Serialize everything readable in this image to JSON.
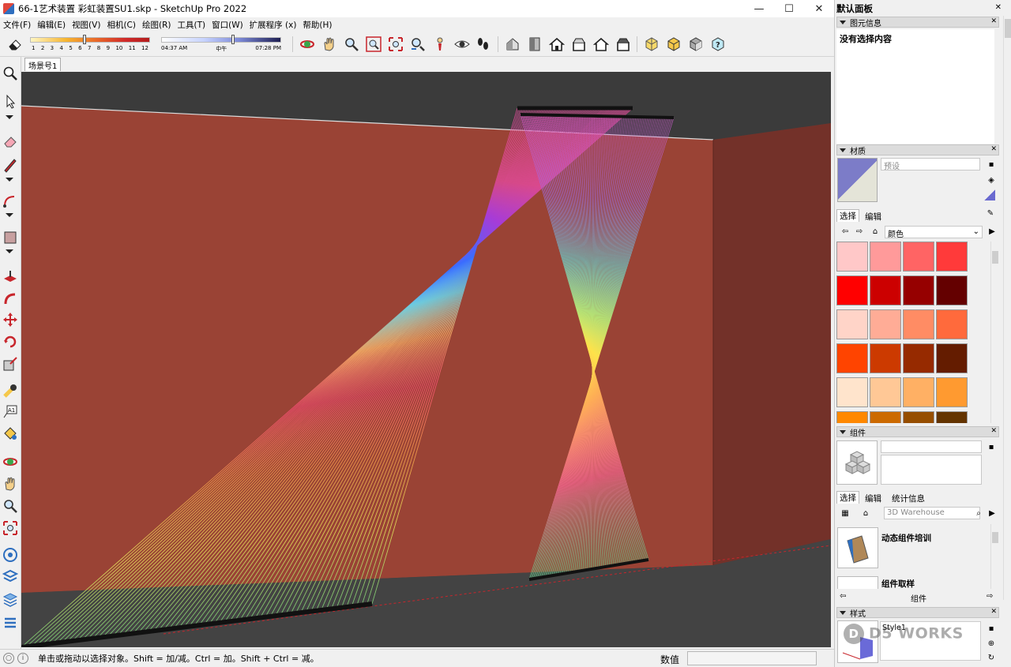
{
  "window": {
    "title": "66-1艺术装置 彩虹装置SU1.skp - SketchUp Pro 2022",
    "minimize": "—",
    "maximize": "☐",
    "close": "✕"
  },
  "menu": [
    "文件(F)",
    "编辑(E)",
    "视图(V)",
    "相机(C)",
    "绘图(R)",
    "工具(T)",
    "窗口(W)",
    "扩展程序 (x)",
    "帮助(H)"
  ],
  "shadows": {
    "month_ticks": [
      "1",
      "2",
      "3",
      "4",
      "5",
      "6",
      "7",
      "8",
      "9",
      "10",
      "11",
      "12"
    ],
    "month_value": 6,
    "time_start": "04:37 AM",
    "time_mid": "中午",
    "time_end": "07:28 PM",
    "time_fraction": 0.6
  },
  "toolbar_icons": [
    "eraser-icon",
    "orbit-icon",
    "pan-icon",
    "zoom-icon",
    "zoom-window-icon",
    "zoom-extents-icon",
    "previous-view-icon",
    "position-camera-icon",
    "look-around-icon",
    "walk-icon",
    "iso-view-icon",
    "top-view-icon",
    "front-view-icon",
    "right-view-icon",
    "back-view-icon",
    "left-view-icon",
    "xray-icon",
    "back-edges-icon",
    "wireframe-icon",
    "help-icon"
  ],
  "scene": {
    "tab_label": "场景号1"
  },
  "status": {
    "hint": "单击或拖动以选择对象。Shift = 加/减。Ctrl = 加。Shift + Ctrl = 减。",
    "measurements_label": "数值",
    "measurements_value": ""
  },
  "tray": {
    "title": "默认面板",
    "entity_info": {
      "header": "图元信息",
      "content": "没有选择内容"
    },
    "materials": {
      "header": "材质",
      "name_placeholder": "预设",
      "tab_select": "选择",
      "tab_edit": "编辑",
      "library": "颜色",
      "swatches": [
        "#ffc8c8",
        "#ff9a9a",
        "#ff6464",
        "#ff3a3a",
        "#ff0000",
        "#cc0000",
        "#960000",
        "#640000",
        "#ffd4c8",
        "#ffac96",
        "#ff8c64",
        "#ff6a3c",
        "#ff4400",
        "#cc3a00",
        "#962a00",
        "#641c00",
        "#ffe4cc",
        "#ffc896",
        "#ffb064",
        "#ff9a30",
        "#ff8800",
        "#cc6a00",
        "#964e00",
        "#643400"
      ]
    },
    "components": {
      "header": "组件",
      "tab_select": "选择",
      "tab_edit": "编辑",
      "tab_stats": "统计信息",
      "search_placeholder": "3D Warehouse",
      "items": [
        {
          "label": "动态组件培训"
        },
        {
          "label": "组件取样"
        }
      ],
      "footer": "组件"
    },
    "styles": {
      "header": "样式",
      "style_name": "Style1"
    }
  },
  "watermark": {
    "logo": "D",
    "text": "D5 WORKS"
  },
  "colors": {
    "wall_left": "#9a4335",
    "wall_right": "#72312a",
    "floor": "#444444",
    "ceiling": "#3a3a3a",
    "accent_blue": "#2f6fbf"
  }
}
